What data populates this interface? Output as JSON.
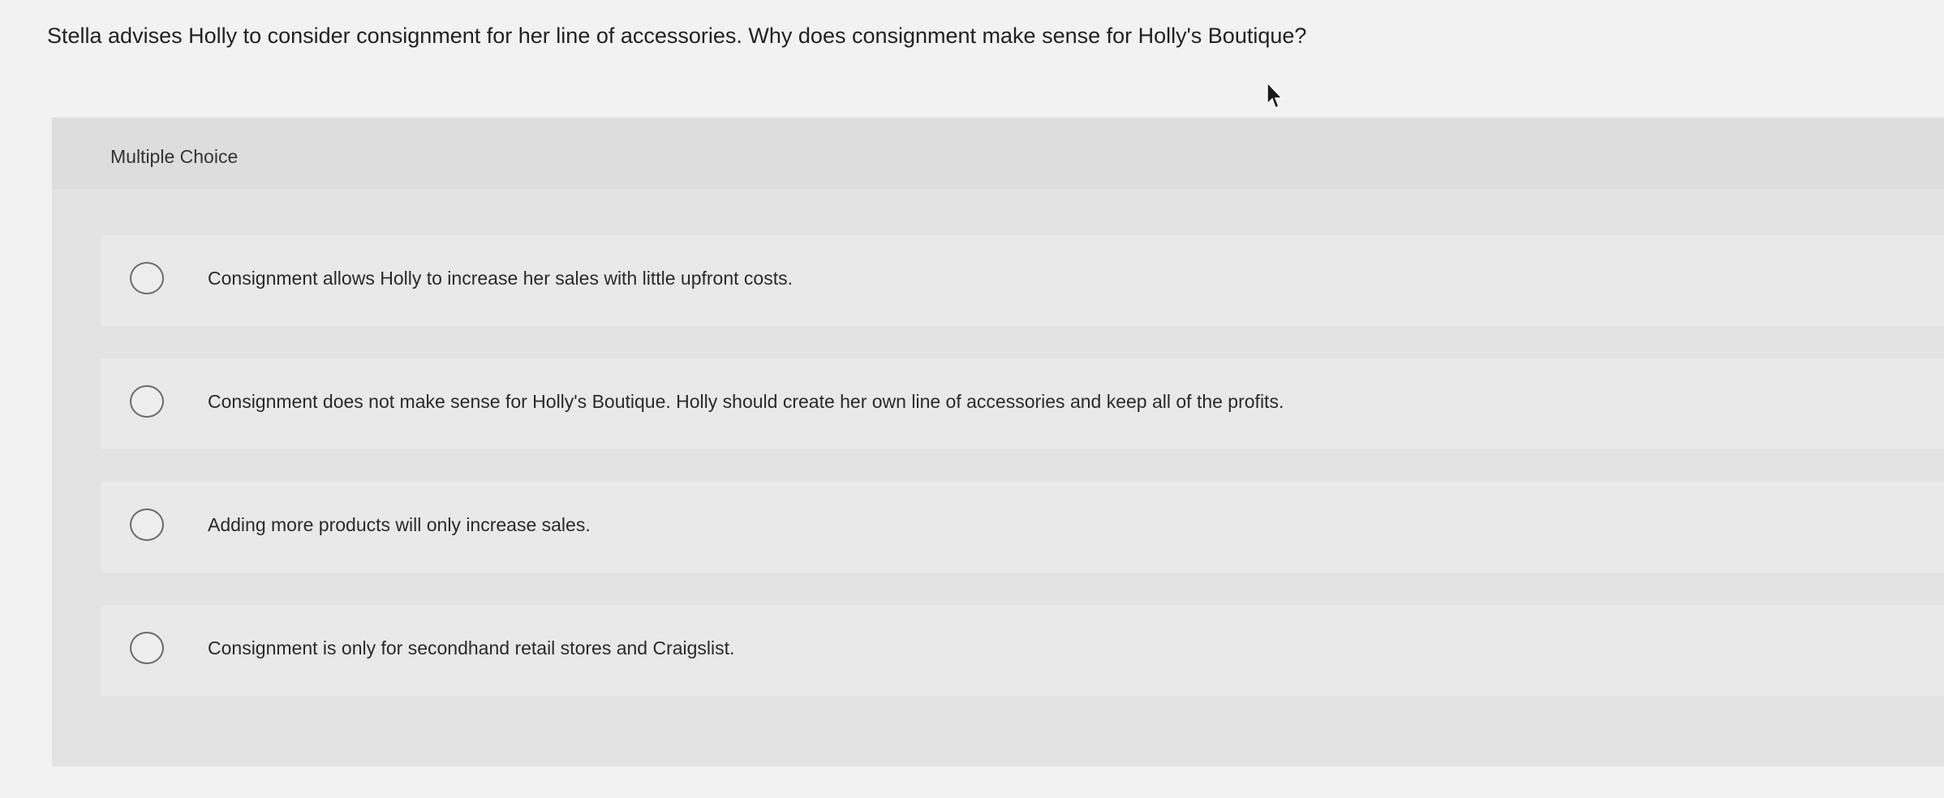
{
  "question": {
    "text": "Stella advises Holly to consider consignment for her line of accessories. Why does consignment make sense for Holly's Boutique?"
  },
  "multiple_choice": {
    "title": "Multiple Choice",
    "options": [
      {
        "label": "Consignment allows Holly to increase her sales with little upfront costs."
      },
      {
        "label": "Consignment does not make sense for Holly's Boutique. Holly should create her own line of accessories and keep all of the profits."
      },
      {
        "label": "Adding more products will only increase sales."
      },
      {
        "label": "Consignment is only for secondhand retail stores and Craigslist."
      }
    ]
  },
  "icons": {
    "radio": "radio-empty-icon",
    "cursor": "mouse-pointer-icon"
  }
}
